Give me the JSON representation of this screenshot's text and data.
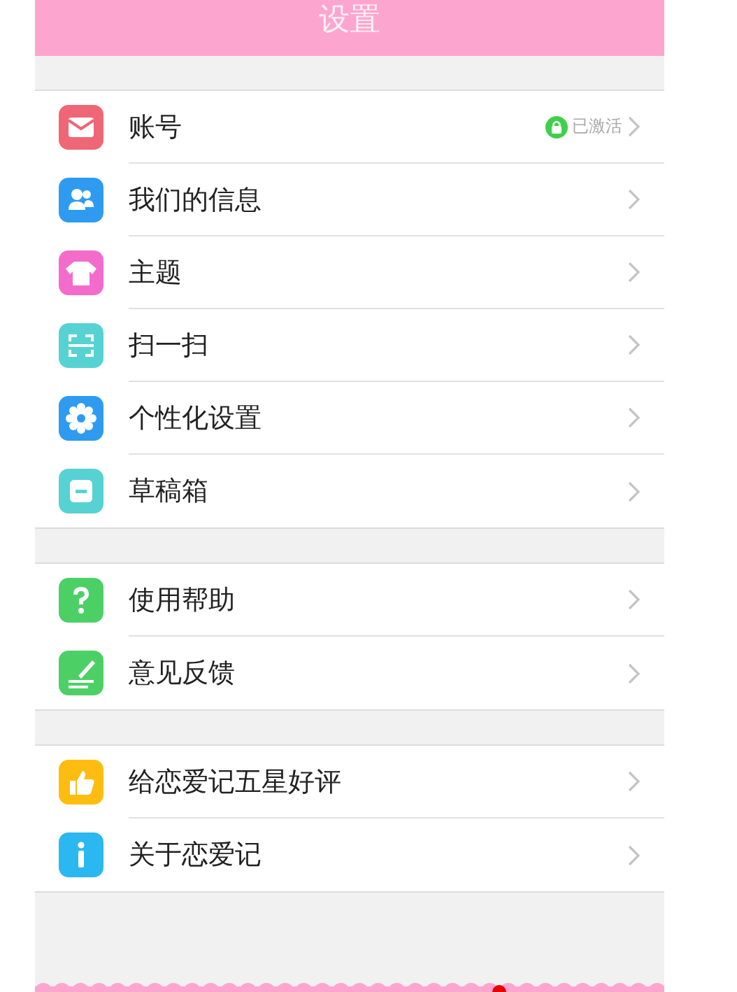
{
  "header": {
    "title": "设置"
  },
  "groups": [
    {
      "items": [
        {
          "label": "账号",
          "status": "已激活"
        },
        {
          "label": "我们的信息"
        },
        {
          "label": "主题"
        },
        {
          "label": "扫一扫"
        },
        {
          "label": "个性化设置"
        },
        {
          "label": "草稿箱"
        }
      ]
    },
    {
      "items": [
        {
          "label": "使用帮助"
        },
        {
          "label": "意见反馈"
        }
      ]
    },
    {
      "items": [
        {
          "label": "给恋爱记五星好评"
        },
        {
          "label": "关于恋爱记"
        }
      ]
    }
  ]
}
